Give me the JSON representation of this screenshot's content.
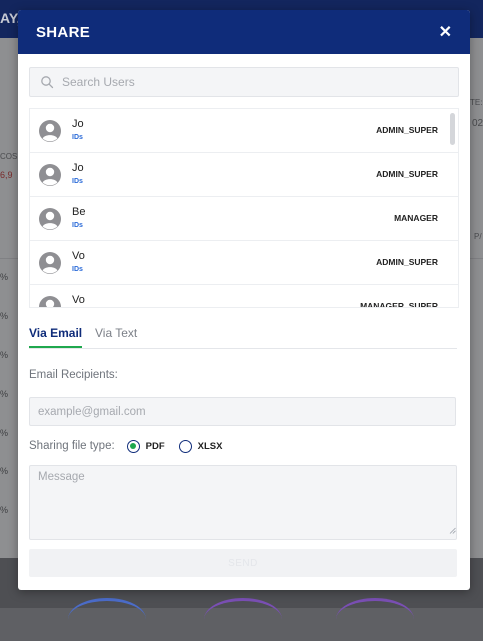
{
  "background": {
    "header_fragment": "AY, !",
    "cost_label_fragment": "COS",
    "cost_value_fragment": "6,9",
    "right_label_fragment": "TE:",
    "right_value_fragment": "02",
    "far_right_fragment": "P/",
    "percent_fragments": [
      "%",
      "%",
      "%",
      "%",
      "%",
      "%",
      "%"
    ]
  },
  "modal": {
    "title": "SHARE",
    "close_icon": "close-icon",
    "search": {
      "placeholder": "Search Users",
      "icon": "search-icon"
    },
    "users": [
      {
        "name": "Jo",
        "id": "IDs",
        "role": "ADMIN_SUPER"
      },
      {
        "name": "Jo",
        "id": "IDs",
        "role": "ADMIN_SUPER"
      },
      {
        "name": "Be",
        "id": "IDs",
        "role": "MANAGER"
      },
      {
        "name": "Vo",
        "id": "IDs",
        "role": "ADMIN_SUPER"
      },
      {
        "name": "Vo",
        "id": "",
        "role": "MANAGER_SUPER"
      }
    ],
    "tabs": {
      "email": "Via Email",
      "text": "Via Text",
      "active": "email"
    },
    "recipients_label": "Email Recipients:",
    "email_placeholder": "example@gmail.com",
    "filetype": {
      "label": "Sharing file type:",
      "options": [
        "PDF",
        "XLSX"
      ],
      "selected": "PDF"
    },
    "message_placeholder": "Message",
    "send_label": "SEND"
  },
  "colors": {
    "header": "#0f2c7a",
    "accent_green": "#1fa84d",
    "id_blue": "#2a6ad8"
  }
}
